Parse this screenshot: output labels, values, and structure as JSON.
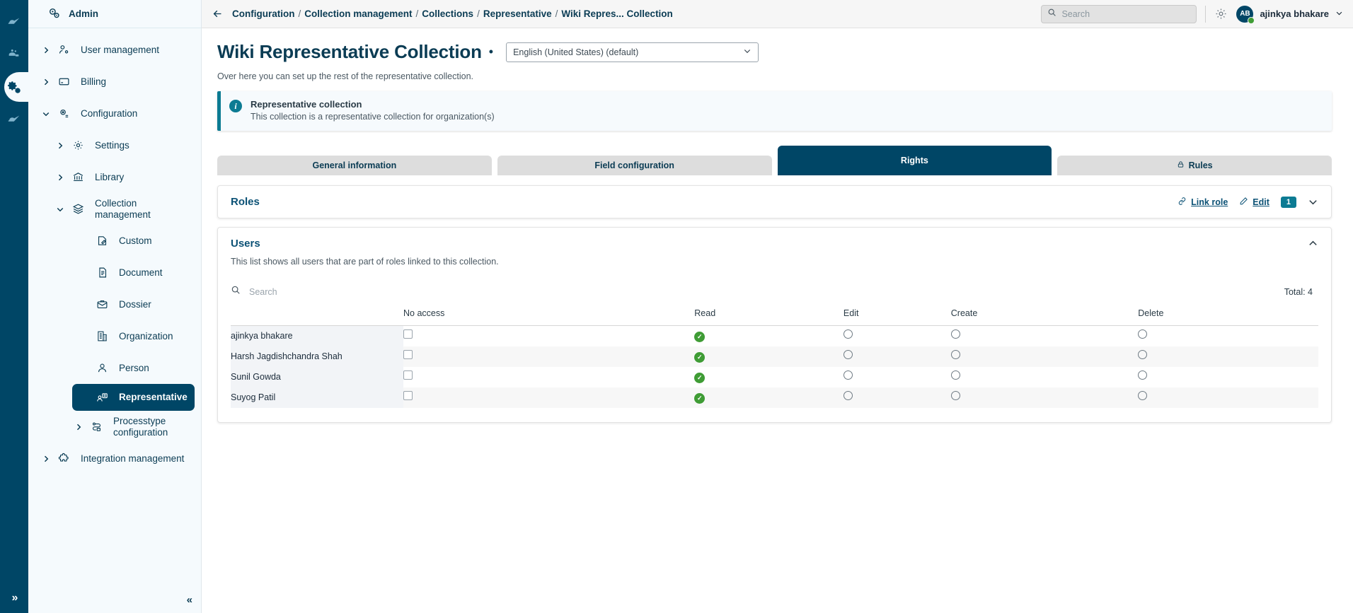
{
  "rail": {
    "items": [
      {
        "name": "cloud-icon",
        "active": false
      },
      {
        "name": "users-group-icon",
        "active": false
      },
      {
        "name": "admin-gears-icon",
        "active": true
      },
      {
        "name": "cloud-alt-icon",
        "active": false
      }
    ],
    "collapse_label": "»"
  },
  "sidebar": {
    "header": {
      "label": "Admin",
      "icon": "admin-gears-icon"
    },
    "collapse_label": "«",
    "items": [
      {
        "label": "User management",
        "icon": "user-settings-icon",
        "level": 0,
        "chevron": "right",
        "active": false
      },
      {
        "label": "Billing",
        "icon": "credit-card-icon",
        "level": 0,
        "chevron": "right",
        "active": false
      },
      {
        "label": "Configuration",
        "icon": "config-gear-icon",
        "level": 0,
        "chevron": "down",
        "active": false
      },
      {
        "label": "Settings",
        "icon": "gear-icon",
        "level": 1,
        "chevron": "right",
        "active": false
      },
      {
        "label": "Library",
        "icon": "library-icon",
        "level": 1,
        "chevron": "right",
        "active": false
      },
      {
        "label": "Collection management",
        "icon": "layers-icon",
        "level": 1,
        "chevron": "down",
        "active": false
      },
      {
        "label": "Custom",
        "icon": "custom-note-icon",
        "level": 2,
        "chevron": "none",
        "active": false
      },
      {
        "label": "Document",
        "icon": "document-icon",
        "level": 2,
        "chevron": "none",
        "active": false
      },
      {
        "label": "Dossier",
        "icon": "dossier-icon",
        "level": 2,
        "chevron": "none",
        "active": false
      },
      {
        "label": "Organization",
        "icon": "organization-icon",
        "level": 2,
        "chevron": "none",
        "active": false
      },
      {
        "label": "Person",
        "icon": "person-icon",
        "level": 2,
        "chevron": "none",
        "active": false
      },
      {
        "label": "Representative",
        "icon": "representative-icon",
        "level": 2,
        "chevron": "none",
        "active": true
      },
      {
        "label": "Processtype configuration",
        "icon": "processtype-icon",
        "level": 2,
        "chevron": "right",
        "active": false
      },
      {
        "label": "Integration management",
        "icon": "puzzle-icon",
        "level": 0,
        "chevron": "right",
        "active": false
      }
    ]
  },
  "topbar": {
    "back_icon": "back-arrow-icon",
    "breadcrumb": [
      "Configuration",
      "Collection management",
      "Collections",
      "Representative",
      "Wiki Repres... Collection"
    ],
    "separator": "/",
    "search": {
      "placeholder": "Search",
      "value": "",
      "icon": "search-icon"
    },
    "gear_icon": "gear-icon",
    "user": {
      "initials": "AB",
      "name": "ajinkya bhakare",
      "status": "online",
      "caret": "⌄"
    }
  },
  "page": {
    "title": "Wiki Representative Collection",
    "bullet": "•",
    "language": {
      "selected": "English (United States) (default)",
      "options": [
        "English (United States) (default)"
      ]
    },
    "subtitle": "Over here you can set up the rest of the representative collection.",
    "info": {
      "icon": "info-icon",
      "title": "Representative collection",
      "text": "This collection is a representative collection for organization(s)"
    },
    "tabs": [
      {
        "label": "General information",
        "active": false,
        "icon": null
      },
      {
        "label": "Field configuration",
        "active": false,
        "icon": null
      },
      {
        "label": "Rights",
        "active": true,
        "icon": null
      },
      {
        "label": "Rules",
        "active": false,
        "icon": "lock-icon"
      }
    ]
  },
  "roles_card": {
    "title": "Roles",
    "link_role_label": "Link role",
    "link_role_icon": "link-icon",
    "edit_label": "Edit",
    "edit_icon": "pencil-icon",
    "count_badge": "1",
    "collapse_icon": "chevron-down-icon"
  },
  "users_card": {
    "title": "Users",
    "collapse_icon": "chevron-up-icon",
    "description": "This list shows all users that are part of roles linked to this collection.",
    "search": {
      "placeholder": "Search",
      "value": "",
      "icon": "search-icon"
    },
    "total_label": "Total: 4",
    "columns": [
      "",
      "No access",
      "Read",
      "Edit",
      "Create",
      "Delete"
    ],
    "rows": [
      {
        "name": "ajinkya bhakare",
        "no_access": false,
        "read": true,
        "edit": false,
        "create": false,
        "delete": false
      },
      {
        "name": "Harsh Jagdishchandra Shah",
        "no_access": false,
        "read": true,
        "edit": false,
        "create": false,
        "delete": false
      },
      {
        "name": "Sunil  Gowda",
        "no_access": false,
        "read": true,
        "edit": false,
        "create": false,
        "delete": false
      },
      {
        "name": "Suyog  Patil",
        "no_access": false,
        "read": true,
        "edit": false,
        "create": false,
        "delete": false
      }
    ]
  },
  "colors": {
    "navy": "#004666",
    "teal": "#0c7b93",
    "green": "#3f9c35",
    "link": "#0b5175"
  }
}
